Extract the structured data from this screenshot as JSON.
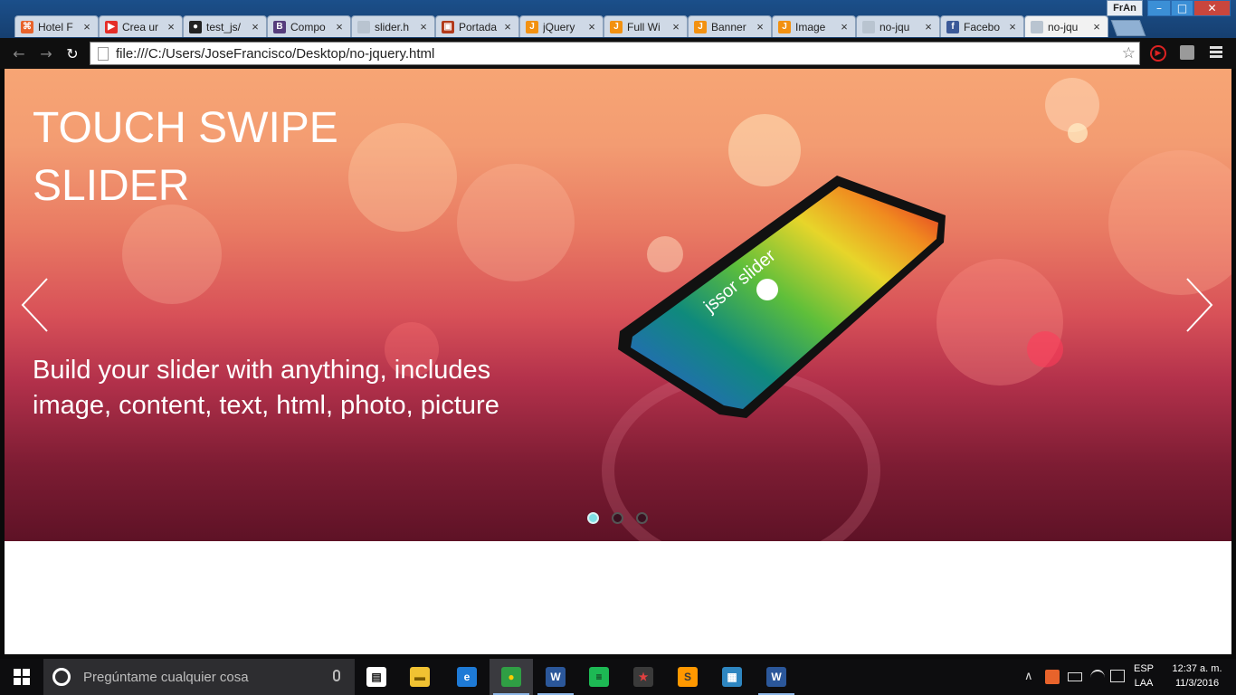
{
  "browser": {
    "user_name": "FrAn",
    "tabs": [
      {
        "title": "Hotel F",
        "icon": "hotel-favicon-icon",
        "color": "#e8632b",
        "glyph": "⌘"
      },
      {
        "title": "Crea ur",
        "icon": "youtube-icon",
        "color": "#e52d27",
        "glyph": "▶"
      },
      {
        "title": "test_js/",
        "icon": "github-icon",
        "color": "#222222",
        "glyph": "●"
      },
      {
        "title": "Compo",
        "icon": "bootstrap-icon",
        "color": "#563d7c",
        "glyph": "B"
      },
      {
        "title": "slider.h",
        "icon": "file-icon",
        "color": "#b9c4d0",
        "glyph": ""
      },
      {
        "title": "Portada",
        "icon": "portada-favicon-icon",
        "color": "#b23a1a",
        "glyph": "▣"
      },
      {
        "title": "jQuery",
        "icon": "jssor-icon",
        "color": "#f29111",
        "glyph": "J"
      },
      {
        "title": "Full Wi",
        "icon": "jssor-icon",
        "color": "#f29111",
        "glyph": "J"
      },
      {
        "title": "Banner",
        "icon": "jssor-icon",
        "color": "#f29111",
        "glyph": "J"
      },
      {
        "title": "Image",
        "icon": "jssor-icon",
        "color": "#f29111",
        "glyph": "J"
      },
      {
        "title": "no-jqu",
        "icon": "file-icon",
        "color": "#b9c4d0",
        "glyph": ""
      },
      {
        "title": "Facebo",
        "icon": "facebook-icon",
        "color": "#3b5998",
        "glyph": "f"
      },
      {
        "title": "no-jqu",
        "icon": "file-icon",
        "color": "#b9c4d0",
        "glyph": "",
        "active": true
      }
    ],
    "close_glyph": "×",
    "window_buttons": {
      "minimize": "–",
      "maximize": "□",
      "close": "✕"
    },
    "nav": {
      "back": "←",
      "forward": "→",
      "reload": "↻",
      "star": "☆",
      "ext_play": "▶"
    },
    "url": "file:///C:/Users/JoseFrancisco/Desktop/no-jquery.html"
  },
  "slider": {
    "title": "TOUCH SWIPE SLIDER",
    "caption": "Build your slider with anything, includes image, content, text, html, photo, picture",
    "phone_screen_text": "jssor slider",
    "bullets": [
      {
        "active": true
      },
      {
        "active": false
      },
      {
        "active": false
      }
    ],
    "active_bullet_color": "#7fe0e6"
  },
  "taskbar": {
    "search_placeholder": "Pregúntame cualquier cosa",
    "apps": [
      {
        "name": "store-icon",
        "glyph": "▤",
        "color": "#ffffff",
        "fg": "#111111"
      },
      {
        "name": "file-explorer-icon",
        "glyph": "▬",
        "color": "#f1c232",
        "fg": "#7a5a00"
      },
      {
        "name": "edge-icon",
        "glyph": "e",
        "color": "#1e7ad6",
        "fg": "#ffffff"
      },
      {
        "name": "chrome-icon",
        "glyph": "●",
        "color": "#2f9e44",
        "fg": "#ffcc00"
      },
      {
        "name": "word-icon",
        "glyph": "W",
        "color": "#2b579a",
        "fg": "#ffffff"
      },
      {
        "name": "spotify-icon",
        "glyph": "≡",
        "color": "#1db954",
        "fg": "#111111"
      },
      {
        "name": "app-game-icon",
        "glyph": "★",
        "color": "#3a3a3a",
        "fg": "#e04040"
      },
      {
        "name": "sublime-icon",
        "glyph": "S",
        "color": "#ff9800",
        "fg": "#3a3a3a"
      },
      {
        "name": "remote-desktop-icon",
        "glyph": "▦",
        "color": "#2e86c1",
        "fg": "#ffffff"
      },
      {
        "name": "word-icon-2",
        "glyph": "W",
        "color": "#2b579a",
        "fg": "#ffffff"
      }
    ],
    "tray_up": "∧",
    "lang_line1": "ESP",
    "lang_line2": "LAA",
    "time": "12:37 a. m.",
    "date": "11/3/2016"
  }
}
